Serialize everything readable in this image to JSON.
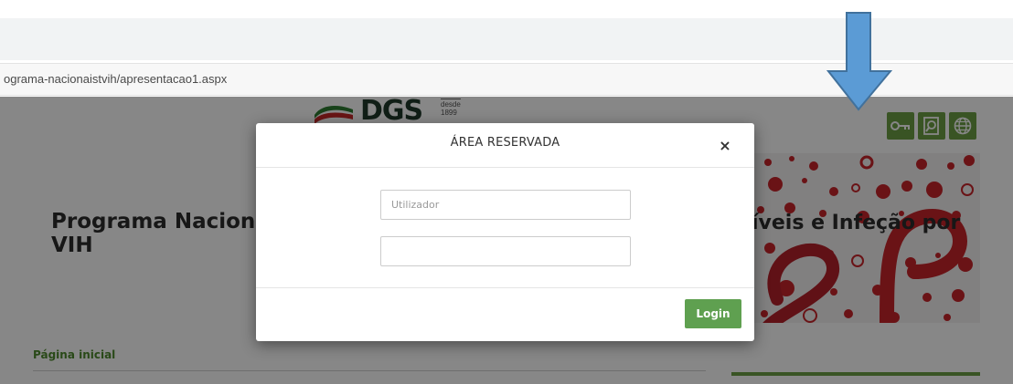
{
  "browser": {
    "url": "ograma-nacionaistvih/apresentacao1.aspx"
  },
  "site": {
    "logo_text": "DGS",
    "logo_since_1": "desde",
    "logo_since_2": "1899",
    "title_left": "Programa Nacional VIH",
    "title_left_line1": "Programa Naciona",
    "title_left_line2": "VIH",
    "title_right": "íveis e Infeção por",
    "home_link": "Página inicial",
    "header_icons": [
      "key-icon",
      "search-document-icon",
      "globe-icon"
    ]
  },
  "modal": {
    "title": "ÁREA RESERVADA",
    "close_label": "×",
    "username_placeholder": "Utilizador",
    "password_value": "",
    "login_label": "Login"
  },
  "colors": {
    "brand_green": "#6d9f45",
    "login_green": "#5fa050",
    "banner_red": "#c8242b",
    "arrow_blue": "#5b9bd5"
  }
}
